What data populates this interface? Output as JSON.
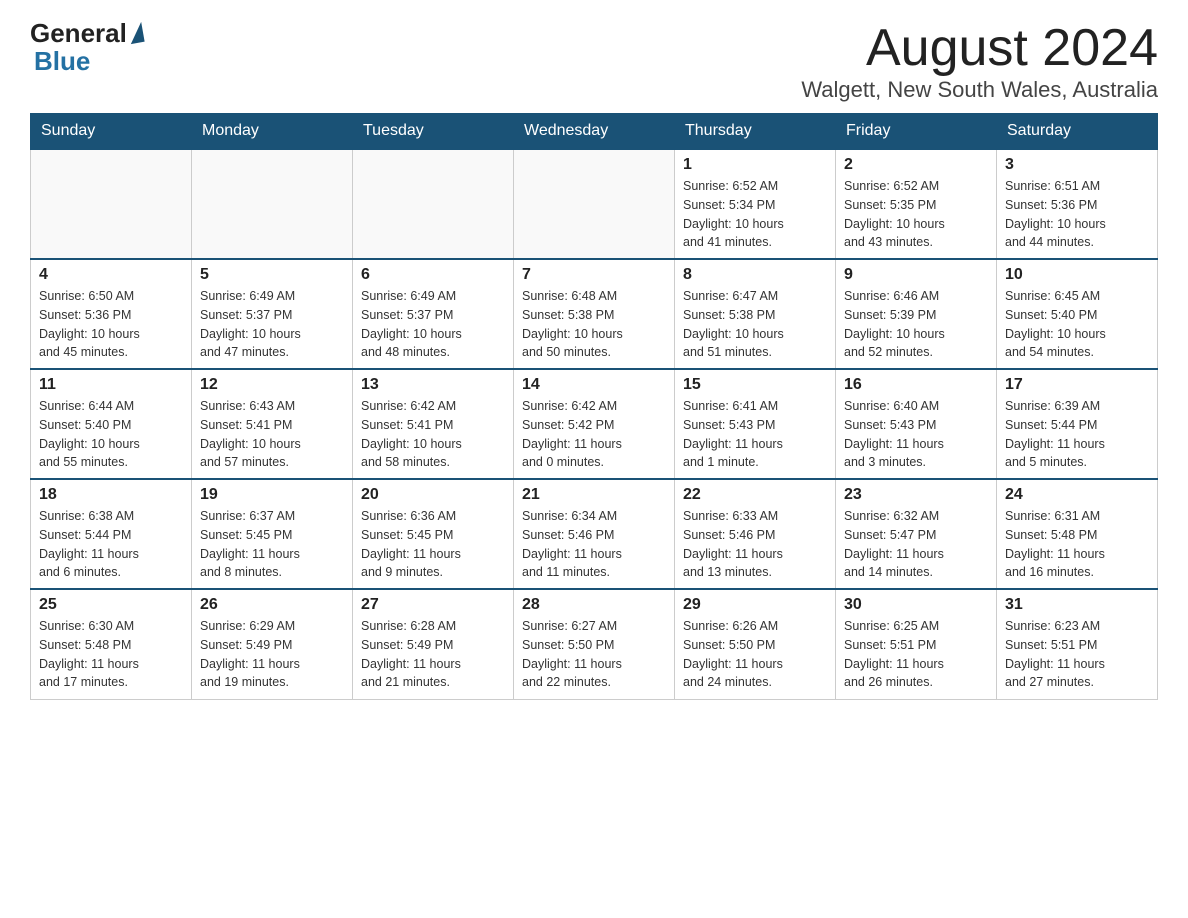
{
  "logo": {
    "general": "General",
    "blue": "Blue"
  },
  "title": "August 2024",
  "subtitle": "Walgett, New South Wales, Australia",
  "days_of_week": [
    "Sunday",
    "Monday",
    "Tuesday",
    "Wednesday",
    "Thursday",
    "Friday",
    "Saturday"
  ],
  "weeks": [
    [
      {
        "day": "",
        "info": ""
      },
      {
        "day": "",
        "info": ""
      },
      {
        "day": "",
        "info": ""
      },
      {
        "day": "",
        "info": ""
      },
      {
        "day": "1",
        "info": "Sunrise: 6:52 AM\nSunset: 5:34 PM\nDaylight: 10 hours\nand 41 minutes."
      },
      {
        "day": "2",
        "info": "Sunrise: 6:52 AM\nSunset: 5:35 PM\nDaylight: 10 hours\nand 43 minutes."
      },
      {
        "day": "3",
        "info": "Sunrise: 6:51 AM\nSunset: 5:36 PM\nDaylight: 10 hours\nand 44 minutes."
      }
    ],
    [
      {
        "day": "4",
        "info": "Sunrise: 6:50 AM\nSunset: 5:36 PM\nDaylight: 10 hours\nand 45 minutes."
      },
      {
        "day": "5",
        "info": "Sunrise: 6:49 AM\nSunset: 5:37 PM\nDaylight: 10 hours\nand 47 minutes."
      },
      {
        "day": "6",
        "info": "Sunrise: 6:49 AM\nSunset: 5:37 PM\nDaylight: 10 hours\nand 48 minutes."
      },
      {
        "day": "7",
        "info": "Sunrise: 6:48 AM\nSunset: 5:38 PM\nDaylight: 10 hours\nand 50 minutes."
      },
      {
        "day": "8",
        "info": "Sunrise: 6:47 AM\nSunset: 5:38 PM\nDaylight: 10 hours\nand 51 minutes."
      },
      {
        "day": "9",
        "info": "Sunrise: 6:46 AM\nSunset: 5:39 PM\nDaylight: 10 hours\nand 52 minutes."
      },
      {
        "day": "10",
        "info": "Sunrise: 6:45 AM\nSunset: 5:40 PM\nDaylight: 10 hours\nand 54 minutes."
      }
    ],
    [
      {
        "day": "11",
        "info": "Sunrise: 6:44 AM\nSunset: 5:40 PM\nDaylight: 10 hours\nand 55 minutes."
      },
      {
        "day": "12",
        "info": "Sunrise: 6:43 AM\nSunset: 5:41 PM\nDaylight: 10 hours\nand 57 minutes."
      },
      {
        "day": "13",
        "info": "Sunrise: 6:42 AM\nSunset: 5:41 PM\nDaylight: 10 hours\nand 58 minutes."
      },
      {
        "day": "14",
        "info": "Sunrise: 6:42 AM\nSunset: 5:42 PM\nDaylight: 11 hours\nand 0 minutes."
      },
      {
        "day": "15",
        "info": "Sunrise: 6:41 AM\nSunset: 5:43 PM\nDaylight: 11 hours\nand 1 minute."
      },
      {
        "day": "16",
        "info": "Sunrise: 6:40 AM\nSunset: 5:43 PM\nDaylight: 11 hours\nand 3 minutes."
      },
      {
        "day": "17",
        "info": "Sunrise: 6:39 AM\nSunset: 5:44 PM\nDaylight: 11 hours\nand 5 minutes."
      }
    ],
    [
      {
        "day": "18",
        "info": "Sunrise: 6:38 AM\nSunset: 5:44 PM\nDaylight: 11 hours\nand 6 minutes."
      },
      {
        "day": "19",
        "info": "Sunrise: 6:37 AM\nSunset: 5:45 PM\nDaylight: 11 hours\nand 8 minutes."
      },
      {
        "day": "20",
        "info": "Sunrise: 6:36 AM\nSunset: 5:45 PM\nDaylight: 11 hours\nand 9 minutes."
      },
      {
        "day": "21",
        "info": "Sunrise: 6:34 AM\nSunset: 5:46 PM\nDaylight: 11 hours\nand 11 minutes."
      },
      {
        "day": "22",
        "info": "Sunrise: 6:33 AM\nSunset: 5:46 PM\nDaylight: 11 hours\nand 13 minutes."
      },
      {
        "day": "23",
        "info": "Sunrise: 6:32 AM\nSunset: 5:47 PM\nDaylight: 11 hours\nand 14 minutes."
      },
      {
        "day": "24",
        "info": "Sunrise: 6:31 AM\nSunset: 5:48 PM\nDaylight: 11 hours\nand 16 minutes."
      }
    ],
    [
      {
        "day": "25",
        "info": "Sunrise: 6:30 AM\nSunset: 5:48 PM\nDaylight: 11 hours\nand 17 minutes."
      },
      {
        "day": "26",
        "info": "Sunrise: 6:29 AM\nSunset: 5:49 PM\nDaylight: 11 hours\nand 19 minutes."
      },
      {
        "day": "27",
        "info": "Sunrise: 6:28 AM\nSunset: 5:49 PM\nDaylight: 11 hours\nand 21 minutes."
      },
      {
        "day": "28",
        "info": "Sunrise: 6:27 AM\nSunset: 5:50 PM\nDaylight: 11 hours\nand 22 minutes."
      },
      {
        "day": "29",
        "info": "Sunrise: 6:26 AM\nSunset: 5:50 PM\nDaylight: 11 hours\nand 24 minutes."
      },
      {
        "day": "30",
        "info": "Sunrise: 6:25 AM\nSunset: 5:51 PM\nDaylight: 11 hours\nand 26 minutes."
      },
      {
        "day": "31",
        "info": "Sunrise: 6:23 AM\nSunset: 5:51 PM\nDaylight: 11 hours\nand 27 minutes."
      }
    ]
  ]
}
